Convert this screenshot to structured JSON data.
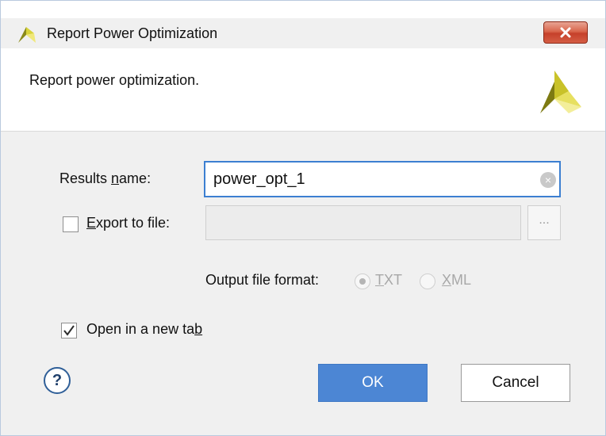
{
  "window": {
    "title": "Report Power Optimization",
    "close_icon": "close-icon",
    "logo_icon": "xilinx-logo-icon"
  },
  "header": {
    "description": "Report power optimization."
  },
  "form": {
    "results_name": {
      "label_pre": "Results ",
      "label_mnemonic": "n",
      "label_post": "ame:",
      "value": "power_opt_1"
    },
    "export_to_file": {
      "checked": false,
      "label_mnemonic": "E",
      "label_post": "xport to file:",
      "value": "",
      "browse_label": "..."
    },
    "output_file_format": {
      "label": "Output file format:",
      "options": [
        {
          "mnemonic": "T",
          "rest": "XT",
          "selected": true
        },
        {
          "mnemonic": "X",
          "rest": "ML",
          "selected": false
        }
      ]
    },
    "open_in_new_tab": {
      "checked": true,
      "label_pre": "Open in a new ta",
      "label_mnemonic": "b"
    }
  },
  "footer": {
    "help_label": "?",
    "ok_label": "OK",
    "cancel_label": "Cancel"
  },
  "colors": {
    "accent": "#4c86d4",
    "focus_border": "#3c7fd1",
    "close_button": "#d9664c"
  }
}
